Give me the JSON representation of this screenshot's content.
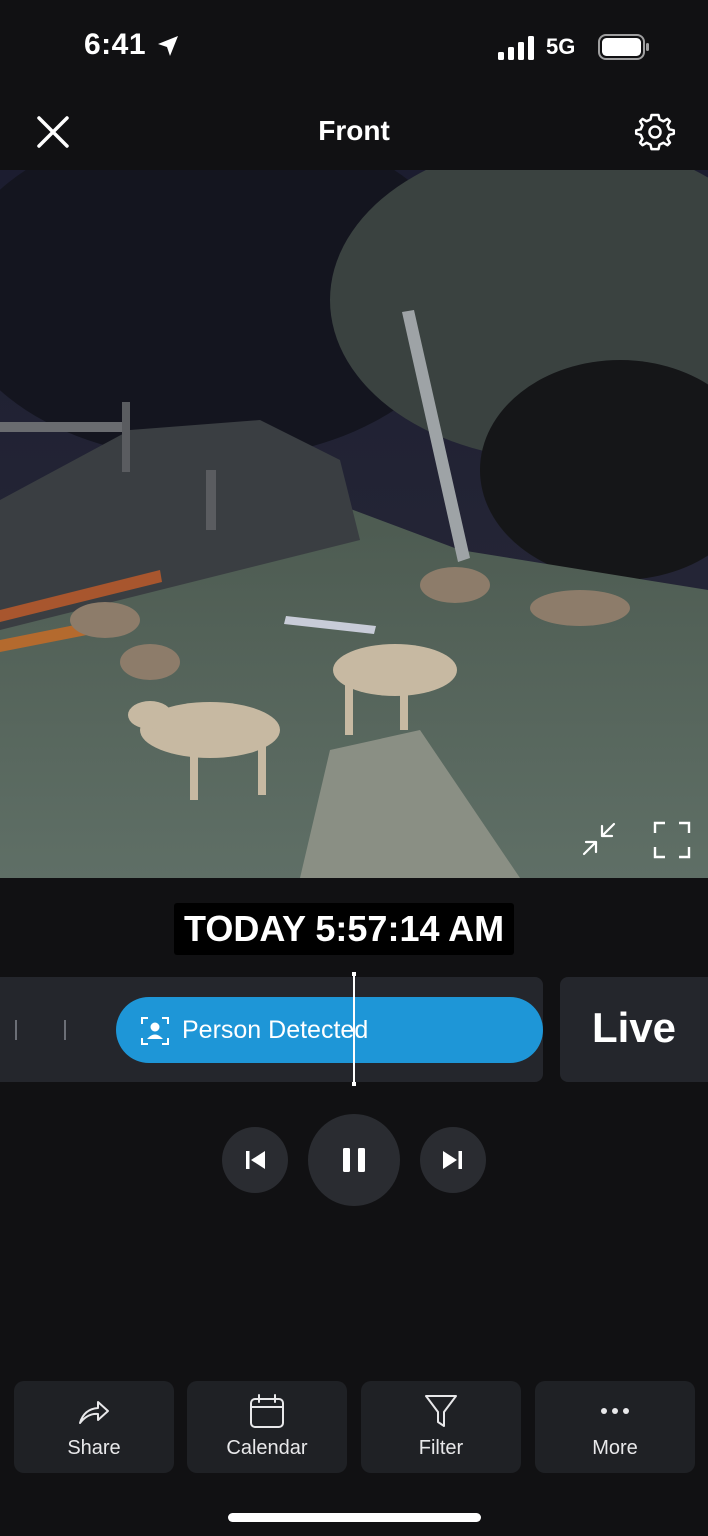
{
  "status_bar": {
    "time": "6:41",
    "network": "5G",
    "icons": [
      "location-arrow-icon",
      "cellular-signal-icon",
      "battery-icon"
    ]
  },
  "header": {
    "title": "Front",
    "icons": [
      "close-icon",
      "gear-icon"
    ]
  },
  "video": {
    "icons": [
      "shrink-icon",
      "fullscreen-icon"
    ]
  },
  "timestamp": "TODAY 5:57:14 AM",
  "timeline": {
    "event_label": "Person Detected",
    "event_icon": "person-detected-icon",
    "live_label": "Live"
  },
  "playback": {
    "icons": [
      "skip-previous-icon",
      "pause-icon",
      "skip-next-icon"
    ]
  },
  "actions": [
    {
      "label": "Share",
      "icon": "share-icon"
    },
    {
      "label": "Calendar",
      "icon": "calendar-icon"
    },
    {
      "label": "Filter",
      "icon": "filter-icon"
    },
    {
      "label": "More",
      "icon": "more-icon"
    }
  ],
  "colors": {
    "background": "#111113",
    "event_blue": "#1e96d7",
    "panel": "#24262c"
  }
}
